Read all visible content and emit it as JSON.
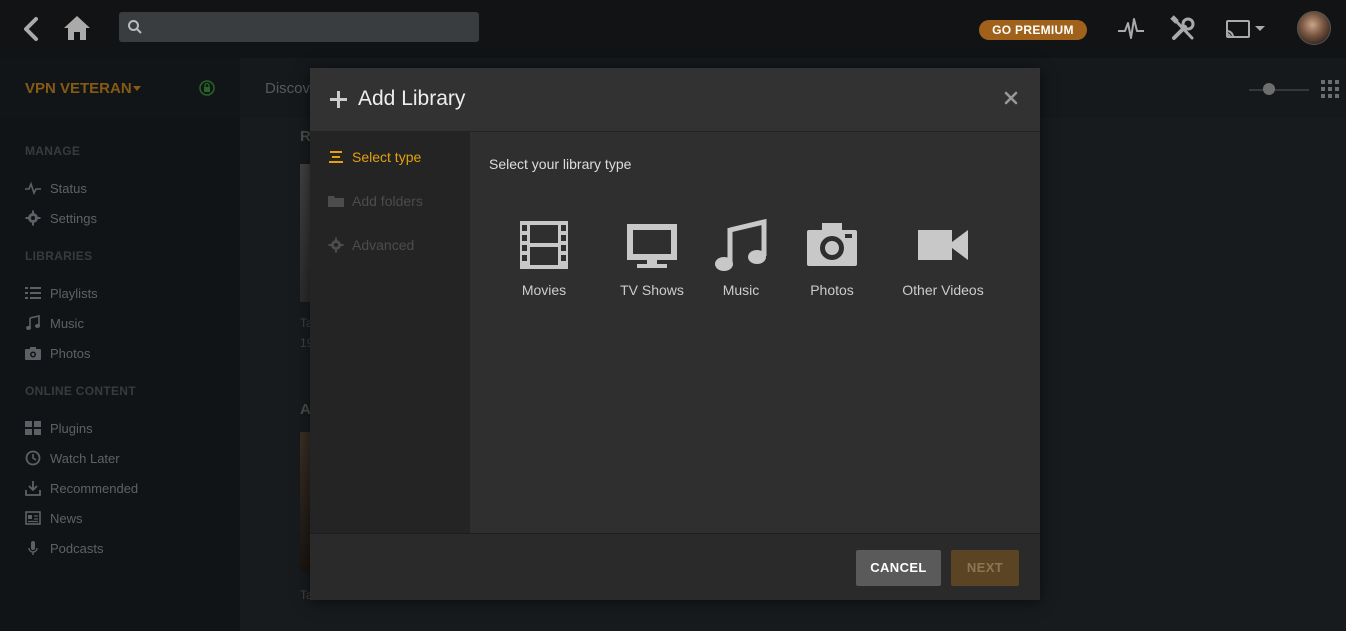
{
  "topbar": {
    "search_placeholder": "",
    "premium_label": "GO PREMIUM",
    "icons": [
      "back-icon",
      "home-icon",
      "search-icon",
      "activity-icon",
      "settings-icon",
      "cast-icon",
      "avatar"
    ]
  },
  "server": {
    "name": "VPN VETERAN"
  },
  "subbar": {
    "discover_label": "Discov"
  },
  "sidebar": {
    "manage_heading": "MANAGE",
    "manage_items": [
      {
        "label": "Status",
        "icon": "pulse-icon"
      },
      {
        "label": "Settings",
        "icon": "gear-icon"
      }
    ],
    "libraries_heading": "LIBRARIES",
    "library_items": [
      {
        "label": "Playlists",
        "icon": "playlist-icon"
      },
      {
        "label": "Music",
        "icon": "music-note-icon"
      },
      {
        "label": "Photos",
        "icon": "camera-icon"
      }
    ],
    "online_heading": "ONLINE CONTENT",
    "online_items": [
      {
        "label": "Plugins",
        "icon": "grid-icon"
      },
      {
        "label": "Watch Later",
        "icon": "clock-icon"
      },
      {
        "label": "Recommended",
        "icon": "download-icon"
      },
      {
        "label": "News",
        "icon": "newspaper-icon"
      },
      {
        "label": "Podcasts",
        "icon": "microphone-icon"
      }
    ]
  },
  "background": {
    "section1_letter": "R",
    "section2_letter": "A",
    "caption1_line1": "Ta",
    "caption1_line2": "19",
    "caption2": "Ta"
  },
  "modal": {
    "title": "Add Library",
    "steps": [
      {
        "label": "Select type",
        "state": "active"
      },
      {
        "label": "Add folders",
        "state": "inactive"
      },
      {
        "label": "Advanced",
        "state": "inactive"
      }
    ],
    "prompt": "Select your library type",
    "library_types": [
      {
        "label": "Movies",
        "icon": "film-icon"
      },
      {
        "label": "TV Shows",
        "icon": "tv-icon"
      },
      {
        "label": "Music",
        "icon": "music-icon"
      },
      {
        "label": "Photos",
        "icon": "camera-icon"
      },
      {
        "label": "Other Videos",
        "icon": "video-camera-icon"
      }
    ],
    "cancel_label": "CANCEL",
    "next_label": "NEXT"
  },
  "colors": {
    "accent": "#e5a00d",
    "premium": "#a0621b",
    "server_name": "#cc8a1d"
  }
}
